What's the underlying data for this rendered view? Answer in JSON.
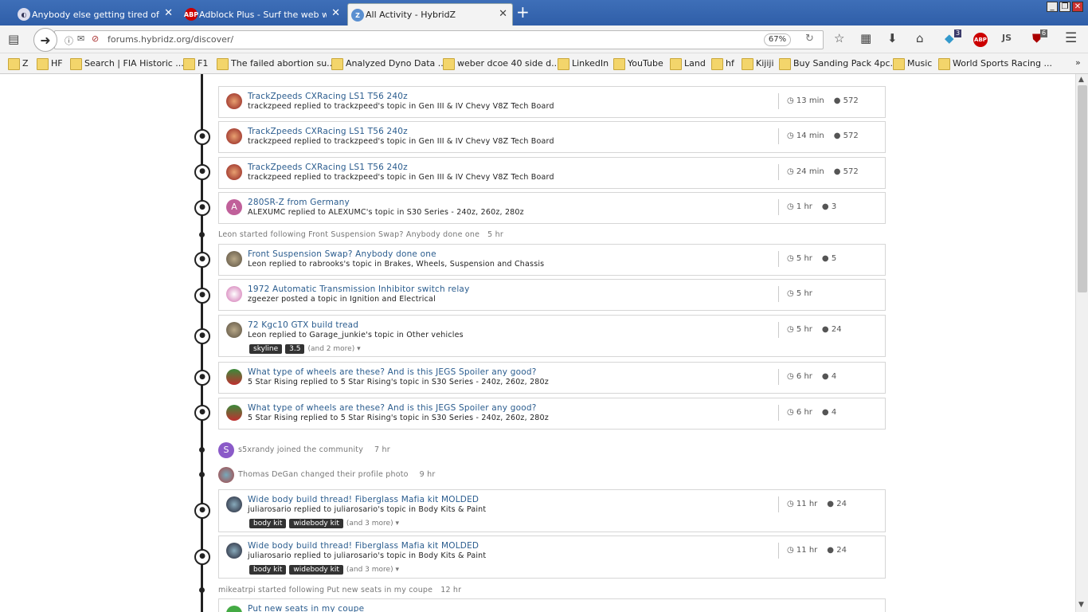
{
  "tabs": [
    {
      "title": "Anybody else getting tired of th",
      "icon": "hybridz-icon"
    },
    {
      "title": "Adblock Plus - Surf the web with",
      "icon": "abp-icon"
    },
    {
      "title": "All Activity - HybridZ",
      "icon": "hybridz-icon"
    }
  ],
  "nav": {
    "url": "forums.hybridz.org/discover/",
    "zoom": "67%",
    "badge1": "3",
    "badge2": "6",
    "js": "JS",
    "abp": "ABP"
  },
  "bookmarks": [
    "Z",
    "HF",
    "Search | FIA Historic ...",
    "F1",
    "The failed abortion su...",
    "Analyzed Dyno Data ...",
    "weber dcoe 40 side d...",
    "LinkedIn",
    "YouTube",
    "Land",
    "hf",
    "Kijiji",
    "Buy Sanding Pack 4pc...",
    "Music",
    "World Sports Racing ..."
  ],
  "activity": [
    {
      "title": "TrackZpeeds CXRacing LS1 T56 240z",
      "sub": "trackzpeed replied to trackzpeed's topic in Gen III & IV Chevy V8Z Tech Board",
      "time": "13 min",
      "comments": "572"
    },
    {
      "title": "TrackZpeeds CXRacing LS1 T56 240z",
      "sub": "trackzpeed replied to trackzpeed's topic in Gen III & IV Chevy V8Z Tech Board",
      "time": "14 min",
      "comments": "572"
    },
    {
      "title": "TrackZpeeds CXRacing LS1 T56 240z",
      "sub": "trackzpeed replied to trackzpeed's topic in Gen III & IV Chevy V8Z Tech Board",
      "time": "24 min",
      "comments": "572"
    },
    {
      "title": "280SR-Z from Germany",
      "sub": "ALEXUMC replied to ALEXUMC's topic in S30 Series - 240z, 260z, 280z",
      "time": "1 hr",
      "comments": "3"
    },
    {
      "title": "Front Suspension Swap? Anybody done one",
      "sub": "Leon replied to rabrooks's topic in Brakes, Wheels, Suspension and Chassis",
      "time": "5 hr",
      "comments": "5"
    },
    {
      "title": "1972 Automatic Transmission Inhibitor switch relay",
      "sub": "zgeezer posted a topic in Ignition and Electrical",
      "time": "5 hr",
      "comments": ""
    },
    {
      "title": "72 Kgc10 GTX build tread",
      "sub": "Leon replied to Garage_junkie's topic in Other vehicles",
      "time": "5 hr",
      "comments": "24",
      "tags": [
        "skyline",
        "3.5"
      ],
      "more": "(and 2 more)"
    },
    {
      "title": "What type of wheels are these? And is this JEGS Spoiler any good?",
      "sub": "5 Star Rising replied to 5 Star Rising's topic in S30 Series - 240z, 260z, 280z",
      "time": "6 hr",
      "comments": "4"
    },
    {
      "title": "What type of wheels are these? And is this JEGS Spoiler any good?",
      "sub": "5 Star Rising replied to 5 Star Rising's topic in S30 Series - 240z, 260z, 280z",
      "time": "6 hr",
      "comments": "4"
    },
    {
      "title": "Wide body build thread! Fiberglass Mafia kit MOLDED",
      "sub": "juliarosario replied to juliarosario's topic in Body Kits & Paint",
      "time": "11 hr",
      "comments": "24",
      "tags": [
        "body kit",
        "widebody kit"
      ],
      "more": "(and 3 more)"
    },
    {
      "title": "Wide body build thread! Fiberglass Mafia kit MOLDED",
      "sub": "juliarosario replied to juliarosario's topic in Body Kits & Paint",
      "time": "11 hr",
      "comments": "24",
      "tags": [
        "body kit",
        "widebody kit"
      ],
      "more": "(and 3 more)"
    },
    {
      "title": "Put new seats in my coupe",
      "sub": "",
      "time": "",
      "comments": ""
    }
  ],
  "events": [
    {
      "text": "Leon started following Front Suspension Swap? Anybody done one",
      "time": "5 hr"
    },
    {
      "text": "s5xrandy joined the community",
      "time": "7 hr",
      "initial": "S"
    },
    {
      "text": "Thomas DeGan changed their profile photo",
      "time": "9 hr"
    },
    {
      "text": "mikeatrpi started following Put new seats in my coupe",
      "time": "12 hr"
    }
  ],
  "avatar_initial_A": "A",
  "colors": {
    "link": "#2a5c8e",
    "timeline": "#222222",
    "titlebar": "#3e6fb8"
  }
}
